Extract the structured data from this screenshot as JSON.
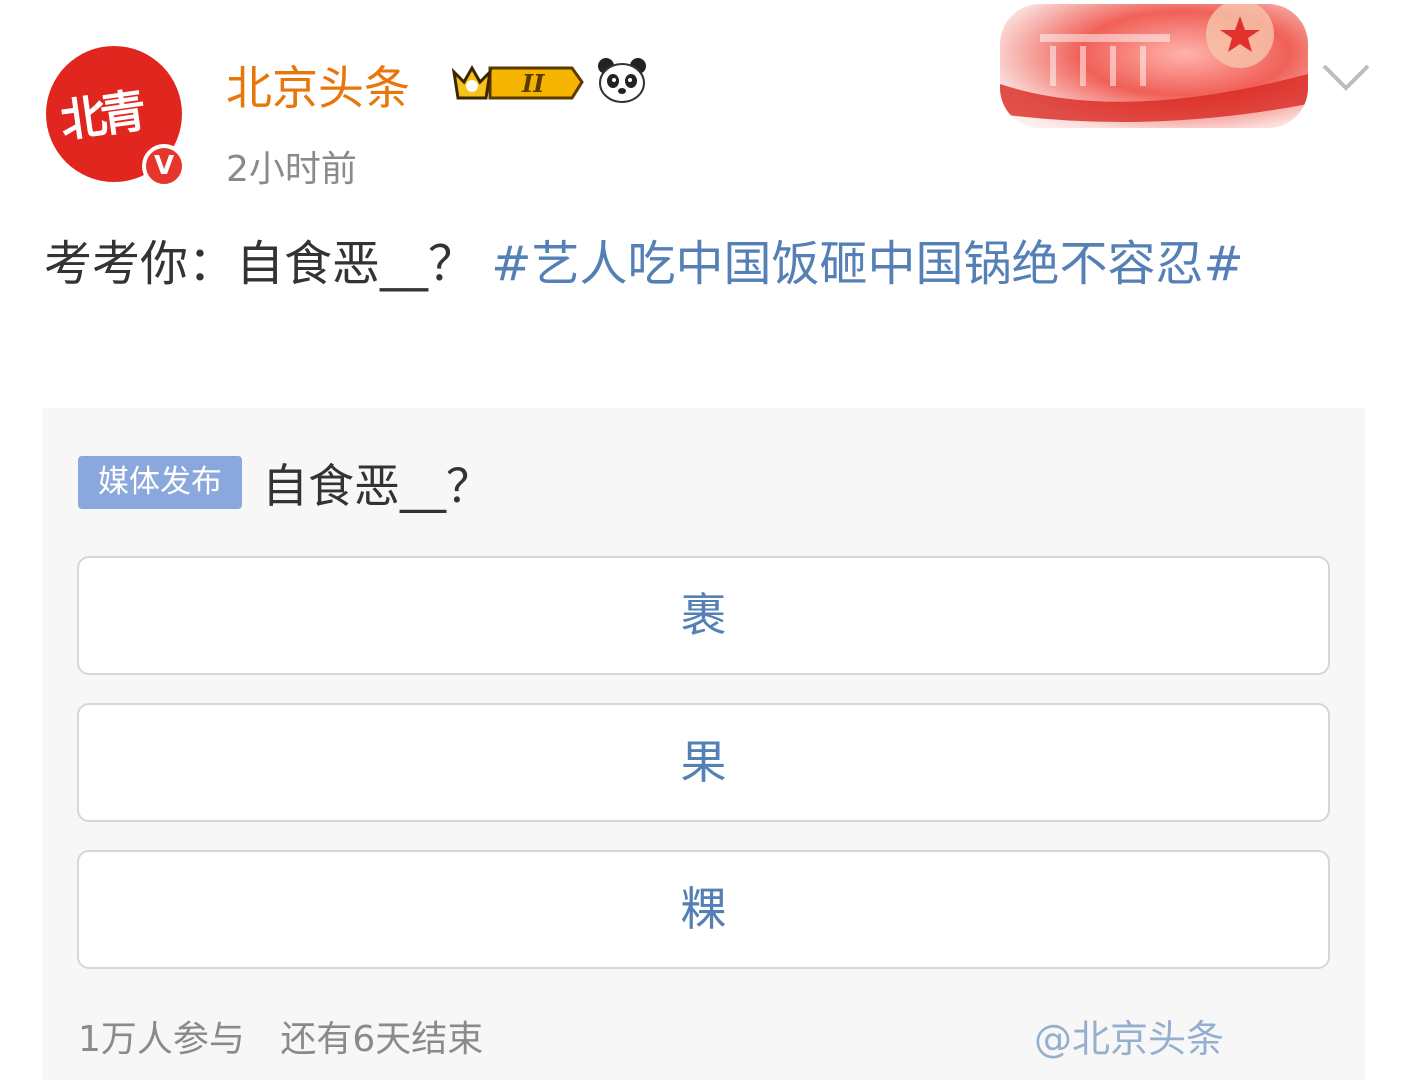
{
  "post": {
    "author": "北京头条",
    "avatar_text": "北青",
    "verified_mark": "V",
    "badge_level": "II",
    "time": "2小时前",
    "text_prefix": "考考你：自食恶__？",
    "topic": "#艺人吃中国饭砸中国锅绝不容忍#"
  },
  "poll": {
    "tag": "媒体发布",
    "question": "自食恶__？",
    "options": [
      "裹",
      "果",
      "粿"
    ],
    "participants": "1万人参与",
    "remaining": "还有6天结束",
    "watermark": "@北京头条"
  },
  "colors": {
    "author_name": "#e8760a",
    "link": "#5580b5",
    "poll_tag_bg": "#8aa8db",
    "avatar_bg": "#e0261f"
  },
  "icons": [
    "crown-level-badge-icon",
    "panda-icon",
    "chevron-down-icon"
  ]
}
